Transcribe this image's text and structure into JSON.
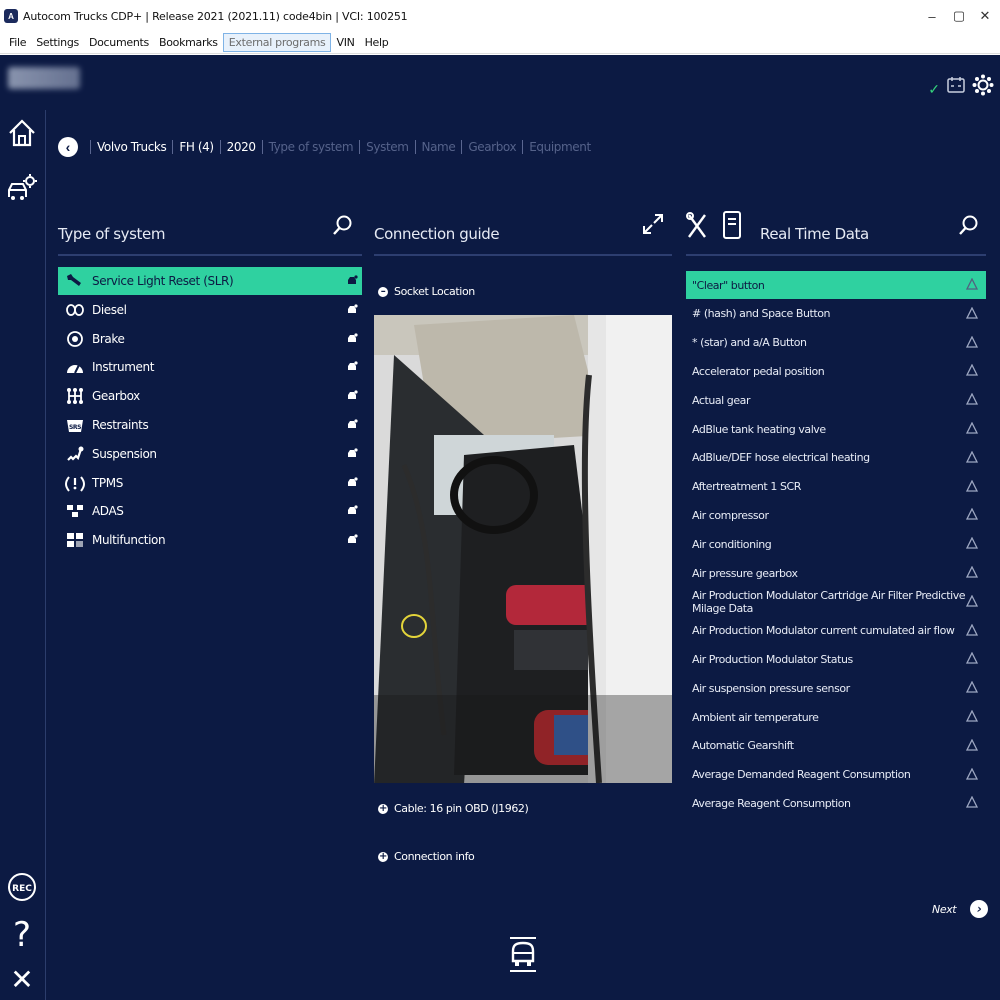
{
  "window": {
    "title": "Autocom Trucks CDP+ | Release 2021 (2021.11) code4bin | VCI: 100251",
    "minimize": "–",
    "maximize": "▢",
    "close": "✕"
  },
  "menu": [
    "File",
    "Settings",
    "Documents",
    "Bookmarks",
    "External programs",
    "VIN",
    "Help"
  ],
  "breadcrumb": {
    "items": [
      {
        "label": "Volvo Trucks",
        "state": "active"
      },
      {
        "label": "FH (4)",
        "state": "active"
      },
      {
        "label": "2020",
        "state": "active"
      },
      {
        "label": "Type of system",
        "state": "inactive"
      },
      {
        "label": "System",
        "state": "inactive"
      },
      {
        "label": "Name",
        "state": "inactive"
      },
      {
        "label": "Gearbox",
        "state": "inactive"
      },
      {
        "label": "Equipment",
        "state": "inactive"
      }
    ]
  },
  "type_of_system": {
    "title": "Type of system",
    "items": [
      {
        "label": "Service Light Reset (SLR)",
        "icon": "wrench-icon",
        "active": true
      },
      {
        "label": "Diesel",
        "icon": "diesel-icon"
      },
      {
        "label": "Brake",
        "icon": "brake-icon"
      },
      {
        "label": "Instrument",
        "icon": "instrument-icon"
      },
      {
        "label": "Gearbox",
        "icon": "gearbox-icon"
      },
      {
        "label": "Restraints",
        "icon": "srs-icon"
      },
      {
        "label": "Suspension",
        "icon": "suspension-icon"
      },
      {
        "label": "TPMS",
        "icon": "tpms-icon"
      },
      {
        "label": "ADAS",
        "icon": "adas-icon"
      },
      {
        "label": "Multifunction",
        "icon": "multifunction-icon"
      }
    ]
  },
  "connection_guide": {
    "title": "Connection guide",
    "socket_location": "Socket Location",
    "cable": "Cable: 16 pin OBD (J1962)",
    "connection_info": "Connection info"
  },
  "real_time_data": {
    "title": "Real Time Data",
    "items": [
      "\"Clear\" button",
      "# (hash) and Space Button",
      "* (star) and a/A Button",
      "Accelerator pedal position",
      "Actual gear",
      "AdBlue tank heating valve",
      "AdBlue/DEF hose electrical heating",
      "Aftertreatment 1 SCR",
      "Air compressor",
      "Air conditioning",
      "Air pressure gearbox",
      "Air Production Modulator Cartridge Air Filter Predictive Milage Data",
      "Air Production Modulator current cumulated air flow",
      "Air Production Modulator Status",
      "Air suspension pressure sensor",
      "Ambient air temperature",
      "Automatic Gearshift",
      "Average Demanded Reagent Consumption",
      "Average Reagent Consumption"
    ],
    "next": "Next"
  },
  "rail": {
    "rec": "REC",
    "help": "?",
    "exit": "✕"
  },
  "colors": {
    "background": "#0c1a43",
    "accent": "#2fd1a0",
    "ok": "#35d27c"
  }
}
